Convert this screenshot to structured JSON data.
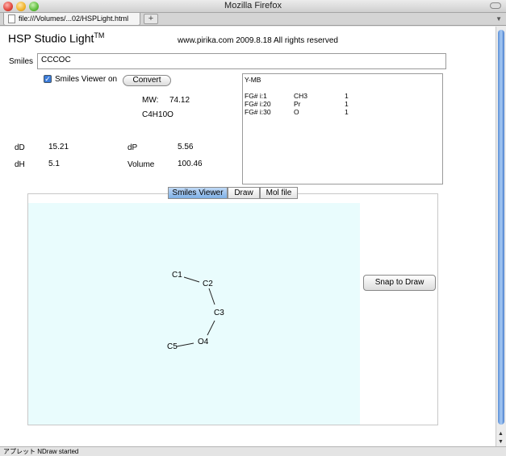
{
  "window": {
    "title": "Mozilla Firefox"
  },
  "browser": {
    "tab_title": "file:///Volumes/...02/HSPLight.html",
    "new_tab": "+"
  },
  "header": {
    "app_title": "HSP Studio Light",
    "tm": "TM",
    "credit": "www.pirika.com  2009.8.18  All rights reserved"
  },
  "smiles": {
    "label": "Smiles",
    "value": "CCCOC"
  },
  "viewer_toggle": {
    "label": "Smiles Viewer on",
    "checked": true,
    "convert": "Convert"
  },
  "molecule": {
    "mw_label": "MW:",
    "mw_value": "74.12",
    "formula": "C4H10O"
  },
  "params": {
    "dD_label": "dD",
    "dD": "15.21",
    "dP_label": "dP",
    "dP": "5.56",
    "dH_label": "dH",
    "dH": "5.1",
    "vol_label": "Volume",
    "vol": "100.46"
  },
  "fg_box": {
    "method": "Y-MB",
    "rows": [
      {
        "id": "FG# i:1",
        "group": "CH3",
        "count": "1"
      },
      {
        "id": "FG# i:20",
        "group": "Pr",
        "count": "1"
      },
      {
        "id": "FG# i:30",
        "group": "O",
        "count": "1"
      }
    ]
  },
  "tabs": [
    {
      "label": "Smiles Viewer",
      "active": true
    },
    {
      "label": "Draw",
      "active": false
    },
    {
      "label": "Mol file",
      "active": false
    }
  ],
  "viewer": {
    "atoms": [
      {
        "label": "C1"
      },
      {
        "label": "C2"
      },
      {
        "label": "C3"
      },
      {
        "label": "O4"
      },
      {
        "label": "C5"
      }
    ],
    "snap_button": "Snap to Draw"
  },
  "status": {
    "text": "アプレット NDraw started"
  },
  "colors": {
    "canvas_bg": "#e9fcfd",
    "accent_blue": "#3b7bd9"
  }
}
